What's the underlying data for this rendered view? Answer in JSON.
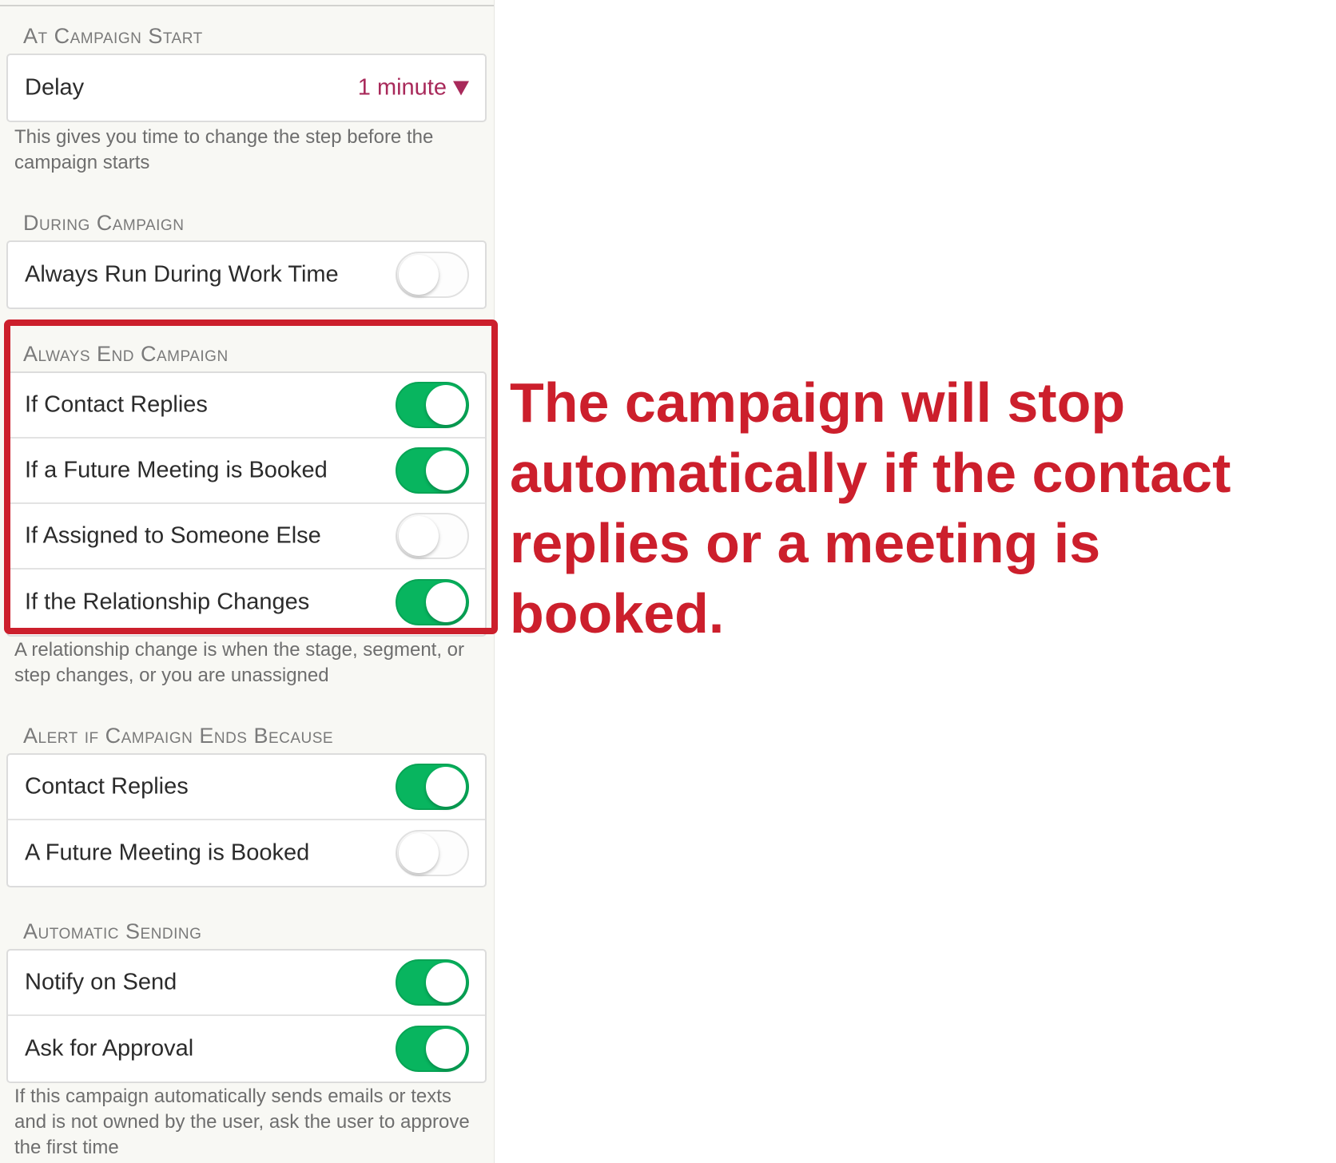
{
  "colors": {
    "accent": "#a8295a",
    "toggle_on": "#08b55f",
    "annotation_red": "#cc1f2c"
  },
  "sections": {
    "campaign_start": {
      "heading": "At Campaign Start",
      "delay": {
        "label": "Delay",
        "value": "1 minute",
        "icon": "caret-down-icon"
      },
      "help": "This gives you time to change the step before the campaign starts"
    },
    "during_campaign": {
      "heading": "During Campaign",
      "rows": [
        {
          "label": "Always Run During Work Time",
          "enabled": false
        }
      ]
    },
    "always_end": {
      "heading": "Always End Campaign",
      "rows": [
        {
          "label": "If Contact Replies",
          "enabled": true
        },
        {
          "label": "If a Future Meeting is Booked",
          "enabled": true
        },
        {
          "label": "If Assigned to Someone Else",
          "enabled": false
        },
        {
          "label": "If the Relationship Changes",
          "enabled": true
        }
      ],
      "help": "A relationship change is when the stage, segment, or step changes, or you are unassigned"
    },
    "alert_if_ends": {
      "heading": "Alert if Campaign Ends Because",
      "rows": [
        {
          "label": "Contact Replies",
          "enabled": true
        },
        {
          "label": "A Future Meeting is Booked",
          "enabled": false
        }
      ]
    },
    "automatic_sending": {
      "heading": "Automatic Sending",
      "rows": [
        {
          "label": "Notify on Send",
          "enabled": true
        },
        {
          "label": "Ask for Approval",
          "enabled": true
        }
      ],
      "help": "If this campaign automatically sends emails or texts and is not owned by the user, ask the user to approve the first time"
    }
  },
  "annotation": {
    "text": "The campaign will stop automatically if the contact replies or a meeting is booked."
  }
}
